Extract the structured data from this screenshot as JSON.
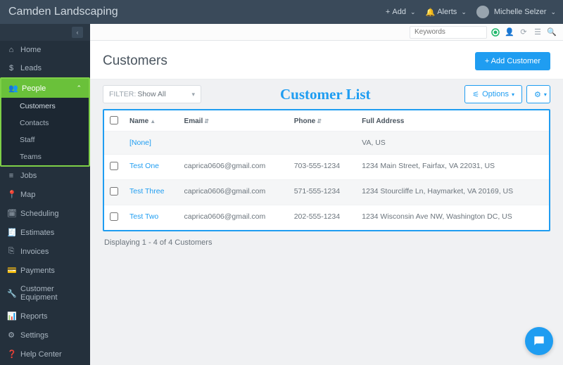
{
  "header": {
    "brand": "Camden Landscaping",
    "add_label": "Add",
    "alerts_label": "Alerts",
    "user_name": "Michelle Selzer"
  },
  "sidebar": {
    "items": [
      {
        "icon": "home-icon",
        "glyph": "⌂",
        "label": "Home"
      },
      {
        "icon": "dollar-icon",
        "glyph": "$",
        "label": "Leads"
      },
      {
        "icon": "people-icon",
        "glyph": "👥",
        "label": "People",
        "active": true
      },
      {
        "icon": "list-icon",
        "glyph": "≡",
        "label": "Jobs"
      },
      {
        "icon": "pin-icon",
        "glyph": "📍",
        "label": "Map"
      },
      {
        "icon": "calendar-icon",
        "glyph": "🗓",
        "label": "Scheduling"
      },
      {
        "icon": "estimate-icon",
        "glyph": "🧾",
        "label": "Estimates"
      },
      {
        "icon": "invoice-icon",
        "glyph": "⎘",
        "label": "Invoices"
      },
      {
        "icon": "card-icon",
        "glyph": "💳",
        "label": "Payments"
      },
      {
        "icon": "wrench-icon",
        "glyph": "🔧",
        "label": "Customer Equipment"
      },
      {
        "icon": "chart-icon",
        "glyph": "📊",
        "label": "Reports"
      },
      {
        "icon": "gear-icon",
        "glyph": "⚙",
        "label": "Settings"
      },
      {
        "icon": "help-icon",
        "glyph": "❓",
        "label": "Help Center"
      }
    ],
    "people_sub": [
      {
        "label": "Customers",
        "selected": true
      },
      {
        "label": "Contacts"
      },
      {
        "label": "Staff"
      },
      {
        "label": "Teams"
      }
    ]
  },
  "toolbar": {
    "keywords_placeholder": "Keywords"
  },
  "page": {
    "title": "Customers",
    "add_button": "+ Add Customer",
    "filter_prefix": "FILTER:",
    "filter_value": "Show All",
    "callout": "Customer List",
    "options_label": "Options"
  },
  "table": {
    "columns": {
      "name": "Name",
      "email": "Email",
      "phone": "Phone",
      "address": "Full Address"
    },
    "rows": [
      {
        "name": "[None]",
        "email": "",
        "phone": "",
        "address": "VA, US"
      },
      {
        "name": "Test One",
        "email": "caprica0606@gmail.com",
        "phone": "703-555-1234",
        "address": "1234 Main Street, Fairfax, VA 22031, US"
      },
      {
        "name": "Test Three",
        "email": "caprica0606@gmail.com",
        "phone": "571-555-1234",
        "address": "1234 Stourcliffe Ln, Haymarket, VA 20169, US"
      },
      {
        "name": "Test Two",
        "email": "caprica0606@gmail.com",
        "phone": "202-555-1234",
        "address": "1234 Wisconsin Ave NW, Washington DC, US"
      }
    ],
    "footer": "Displaying 1 - 4 of 4 Customers"
  }
}
